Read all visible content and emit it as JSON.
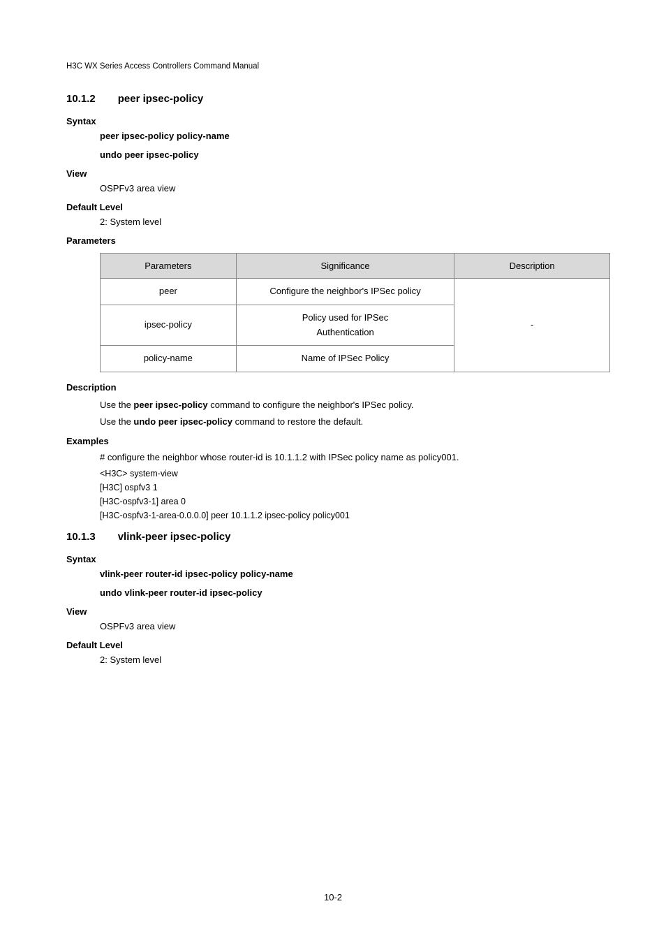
{
  "header": "H3C WX Series Access Controllers Command Manual",
  "section": {
    "number": "10.1.2",
    "title": "peer ipsec-policy"
  },
  "syntax": {
    "heading": "Syntax",
    "lines": [
      "peer ipsec-policy policy-name",
      "undo peer ipsec-policy"
    ]
  },
  "view": {
    "heading": "View",
    "value": "OSPFv3 area view"
  },
  "defaultLevel": {
    "heading": "Default Level",
    "value": "2: System level"
  },
  "parameters": {
    "heading": "Parameters",
    "columns": [
      "Parameters",
      "Significance",
      "Description"
    ],
    "rows": [
      {
        "param": "peer",
        "sig": "Configure the neighbor's IPSec policy",
        "desc": ""
      },
      {
        "param": "ipsec-policy",
        "sig": "Policy used for IPSec\nAuthentication",
        "desc": ""
      },
      {
        "param": "policy-name",
        "sig": "Name of IPSec Policy",
        "desc": ""
      }
    ],
    "mergedDescription": "-"
  },
  "description": {
    "heading": "Description",
    "paragraphs": [
      {
        "pre": "Use the ",
        "bold": "peer ipsec-policy",
        "post": " command to configure the neighbor's IPSec policy."
      },
      {
        "pre": "Use the ",
        "bold": "undo peer ipsec-policy",
        "post": " command to restore the default."
      }
    ]
  },
  "examples": {
    "heading": "Examples",
    "intro": "# configure the neighbor whose router-id is 10.1.1.2 with IPSec policy name as policy001.",
    "code": "<H3C> system-view\n[H3C] ospfv3 1\n[H3C-ospfv3-1] area 0\n[H3C-ospfv3-1-area-0.0.0.0] peer 10.1.1.2 ipsec-policy policy001"
  },
  "section2": {
    "number": "10.1.3",
    "title": "vlink-peer ipsec-policy"
  },
  "syntax2": {
    "heading": "Syntax",
    "lines": [
      "vlink-peer router-id ipsec-policy policy-name",
      "undo vlink-peer router-id ipsec-policy"
    ]
  },
  "view2": {
    "heading": "View",
    "value": "OSPFv3 area view"
  },
  "defaultLevel2": {
    "heading": "Default Level",
    "value": "2: System level"
  },
  "pageNumber": "10-2"
}
